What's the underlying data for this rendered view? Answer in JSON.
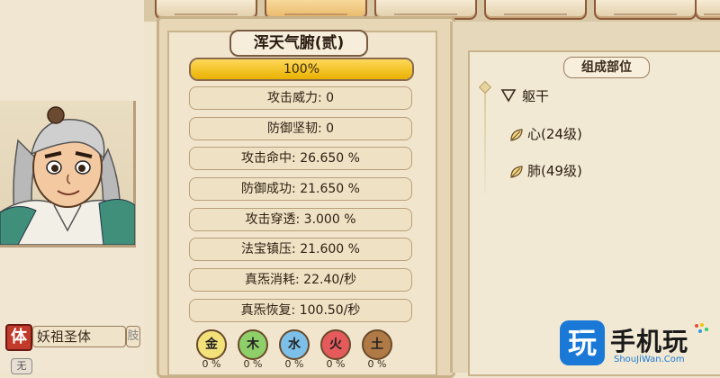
{
  "colors": {
    "accent_bar": "#f0c020",
    "frame_brown": "#8c5a3a",
    "watermark_blue": "#1a79d6"
  },
  "tabs": [
    {
      "active": false
    },
    {
      "active": true
    },
    {
      "active": false
    },
    {
      "active": false
    },
    {
      "active": false
    },
    {
      "active": false
    }
  ],
  "character": {
    "body_tag": "体",
    "body_name": "妖祖圣体",
    "more": "肢",
    "extra_tag": "无"
  },
  "stats_panel": {
    "title": "浑天气腑(贰)",
    "progress_text": "100%",
    "progress_fraction": 1.0,
    "rows": [
      "攻击威力: 0",
      "防御坚韧: 0",
      "攻击命中: 26.650 %",
      "防御成功: 21.650 %",
      "攻击穿透: 3.000 %",
      "法宝镇压: 21.600 %",
      "真炁消耗: 22.40/秒",
      "真炁恢复: 100.50/秒"
    ],
    "elements": [
      {
        "label": "金",
        "pct": "0 %",
        "color": "#f3e27a"
      },
      {
        "label": "木",
        "pct": "0 %",
        "color": "#8fcf6a"
      },
      {
        "label": "水",
        "pct": "0 %",
        "color": "#7cc0ea"
      },
      {
        "label": "火",
        "pct": "0 %",
        "color": "#e55a5a"
      },
      {
        "label": "土",
        "pct": "0 %",
        "color": "#b07a46"
      }
    ]
  },
  "composition": {
    "title": "组成部位",
    "root": "躯干",
    "children": [
      "心(24级)",
      "肺(49级)"
    ]
  },
  "watermark": {
    "icon": "玩",
    "text": "手机玩",
    "sub": "ShouJiWan.Com"
  }
}
